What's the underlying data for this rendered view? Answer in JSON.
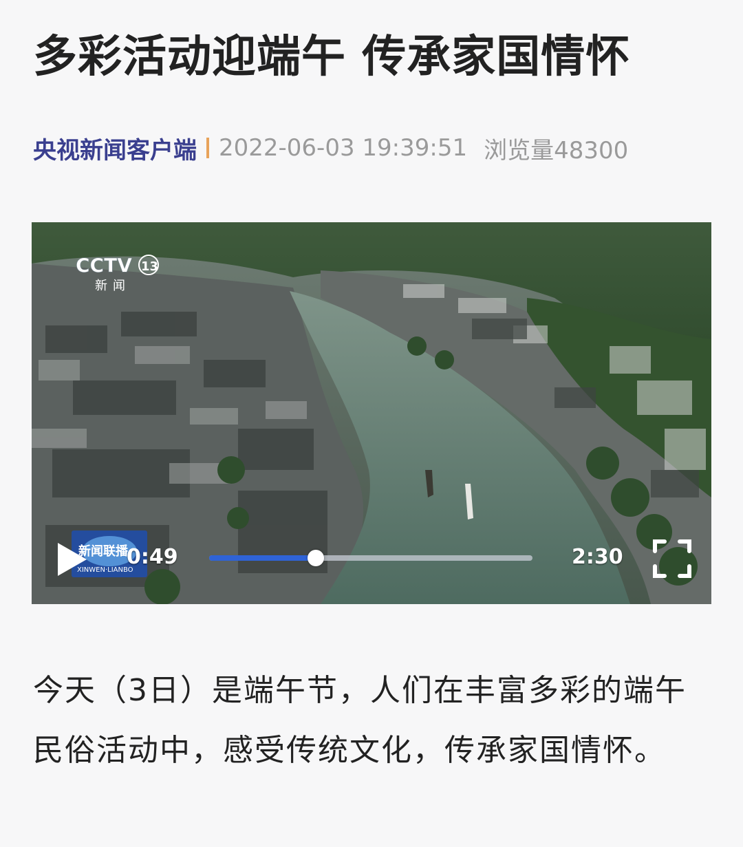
{
  "article": {
    "title": "多彩活动迎端午 传承家国情怀",
    "source": "央视新闻客户端",
    "datetime": "2022-06-03 19:39:51",
    "views": "浏览量48300",
    "paragraph": "今天（3日）是端午节，人们在丰富多彩的端午民俗活动中，感受传统文化，传承家国情怀。"
  },
  "video": {
    "channel_logo": "CCTV 13 新闻",
    "program_logo": "新闻联播 XINWEN LIANBO",
    "current_time": "0:49",
    "total_time": "2:30",
    "progress": 0.33,
    "icons": {
      "play": "play-icon",
      "fullscreen": "fullscreen-icon"
    }
  },
  "colors": {
    "source": "#3a3f8f",
    "separator": "#e8a35a",
    "meta_gray": "#9a9a9a",
    "progress_fill": "#2f63d6",
    "background": "#f7f7f8"
  }
}
